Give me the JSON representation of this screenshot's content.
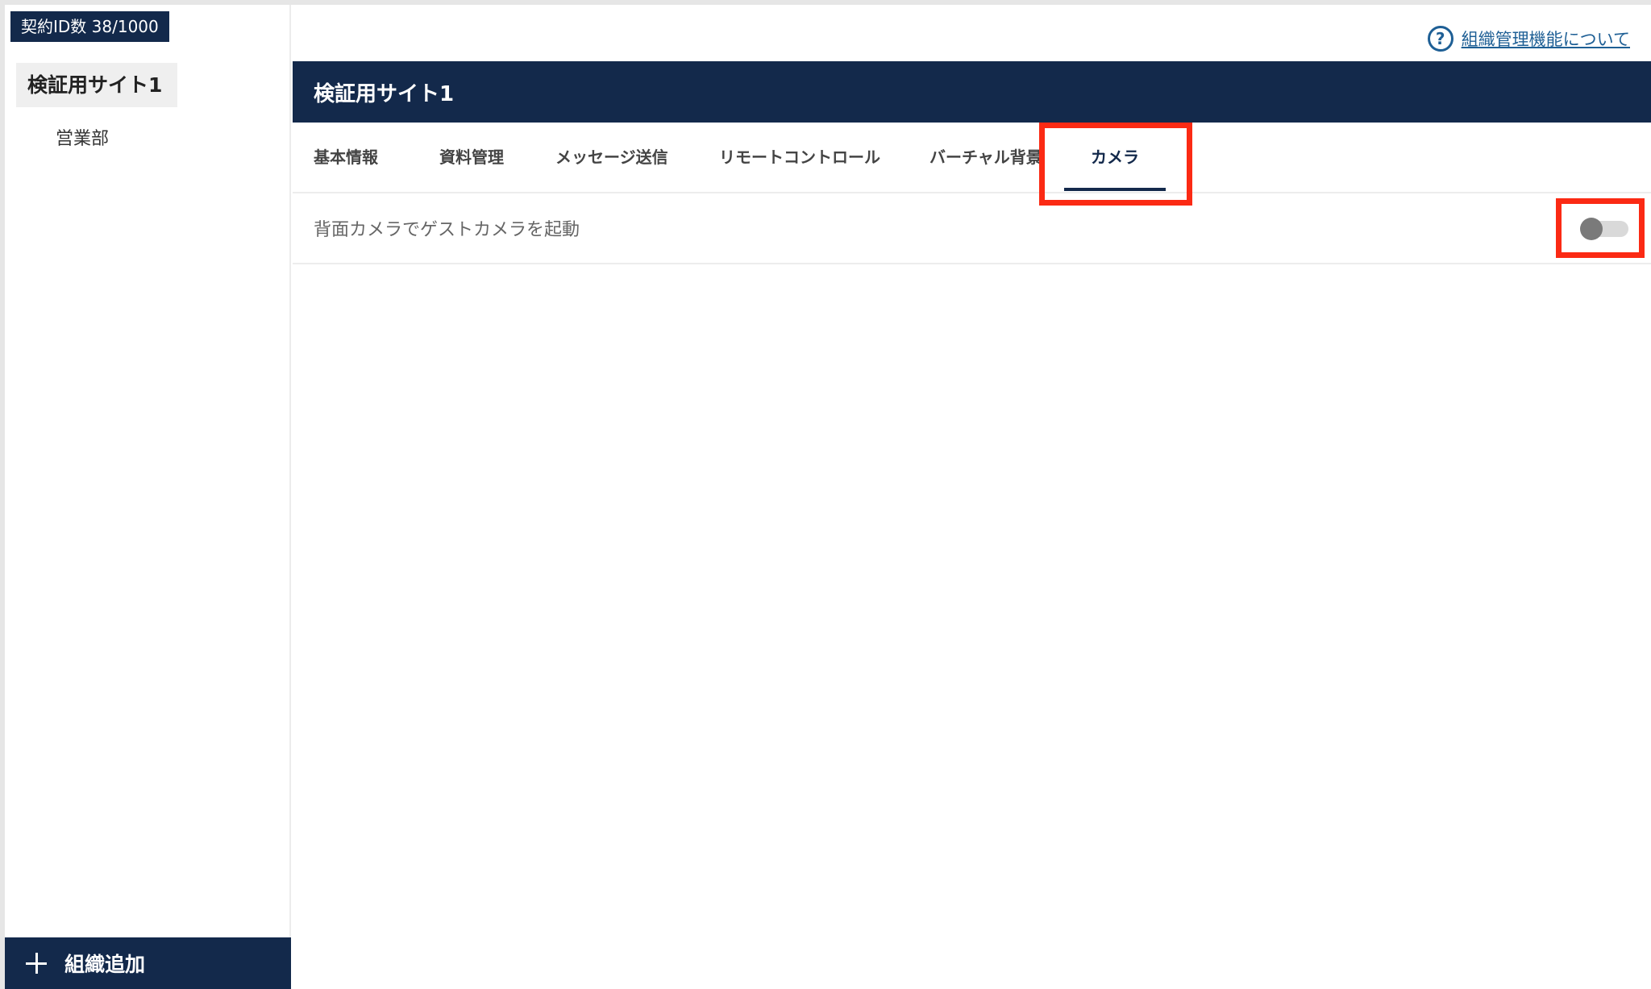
{
  "sidebar": {
    "contract_badge": "契約ID数 38/1000",
    "org_root": "検証用サイト1",
    "org_children": [
      "営業部"
    ],
    "add_org_label": "組織追加"
  },
  "help": {
    "icon": "question-circle-icon",
    "link_text": "組織管理機能について"
  },
  "header": {
    "title": "検証用サイト1"
  },
  "tabs": [
    {
      "label": "基本情報",
      "active": false
    },
    {
      "label": "資料管理",
      "active": false
    },
    {
      "label": "メッセージ送信",
      "active": false
    },
    {
      "label": "リモートコントロール",
      "active": false
    },
    {
      "label": "バーチャル背景",
      "active": false
    },
    {
      "label": "カメラ",
      "active": true
    }
  ],
  "settings": [
    {
      "label": "背面カメラでゲストカメラを起動",
      "enabled": false
    }
  ],
  "colors": {
    "navy": "#13294b",
    "highlight": "#fb2a14",
    "link": "#1e5f95"
  }
}
